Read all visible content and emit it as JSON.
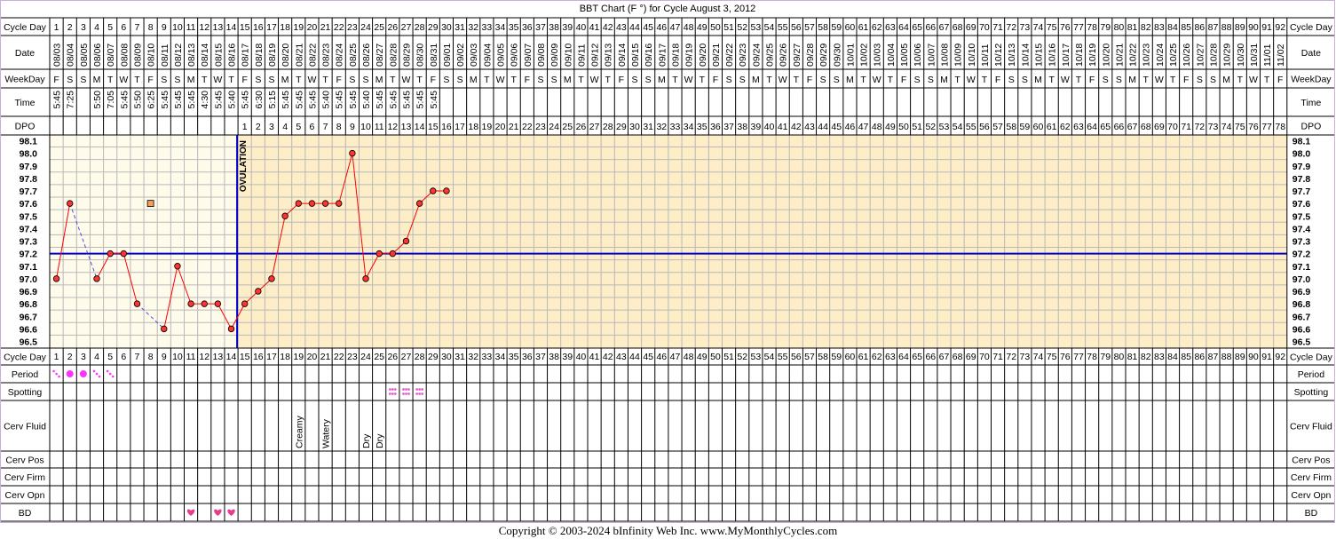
{
  "title": "BBT Chart (F °) for Cycle August 3, 2012",
  "row_labels": {
    "cycle_day": "Cycle Day",
    "date": "Date",
    "weekday": "WeekDay",
    "time": "Time",
    "dpo": "DPO",
    "period": "Period",
    "spotting": "Spotting",
    "cerv_fluid": "Cerv Fluid",
    "cerv_pos": "Cerv Pos",
    "cerv_firm": "Cerv Firm",
    "cerv_opn": "Cerv Opn",
    "bd": "BD"
  },
  "ovulation_label": "OVULATION",
  "ovulation_day": 14,
  "coverline": 97.2,
  "copyright": "Copyright © 2003-2024 bInfinity Web Inc.     www.MyMonthlyCycles.com",
  "colors": {
    "background": "#ffffff",
    "pre_ovulation_fill": "#fffbea",
    "post_ovulation_fill": "#fdeec8",
    "border": "#000000",
    "grid": "#b8b8b8",
    "ovulation_line": "#0000cc",
    "coverline": "#0000cc",
    "temp_line": "#ff0000",
    "temp_point": "#ff3333",
    "dashed_line": "#5050e0",
    "period": "#ff33ff",
    "spotting": "#e060d0",
    "heart": "#e83c8c"
  },
  "chart_data": {
    "type": "line",
    "title": "BBT Chart (F °) for Cycle August 3, 2012",
    "days": 92,
    "dates": [
      "08/03",
      "08/04",
      "08/05",
      "08/06",
      "08/07",
      "08/08",
      "08/09",
      "08/10",
      "08/11",
      "08/12",
      "08/13",
      "08/14",
      "08/15",
      "08/16",
      "08/17",
      "08/18",
      "08/19",
      "08/20",
      "08/21",
      "08/22",
      "08/23",
      "08/24",
      "08/25",
      "08/26",
      "08/27",
      "08/28",
      "08/29",
      "08/30",
      "08/31",
      "09/01",
      "09/02",
      "09/03",
      "09/04",
      "09/05",
      "09/06",
      "09/07",
      "09/08",
      "09/09",
      "09/10",
      "09/11",
      "09/12",
      "09/13",
      "09/14",
      "09/15",
      "09/16",
      "09/17",
      "09/18",
      "09/19",
      "09/20",
      "09/21",
      "09/22",
      "09/23",
      "09/24",
      "09/25",
      "09/26",
      "09/27",
      "09/28",
      "09/29",
      "09/30",
      "10/01",
      "10/02",
      "10/03",
      "10/04",
      "10/05",
      "10/06",
      "10/07",
      "10/08",
      "10/09",
      "10/10",
      "10/11",
      "10/12",
      "10/13",
      "10/14",
      "10/15",
      "10/16",
      "10/17",
      "10/18",
      "10/19",
      "10/20",
      "10/21",
      "10/22",
      "10/23",
      "10/24",
      "10/25",
      "10/26",
      "10/27",
      "10/28",
      "10/29",
      "10/30",
      "10/31",
      "11/01",
      "11/02"
    ],
    "weekdays": [
      "F",
      "S",
      "S",
      "M",
      "T",
      "W",
      "T",
      "F",
      "S",
      "S",
      "M",
      "T",
      "W",
      "T",
      "F",
      "S",
      "S",
      "M",
      "T",
      "W",
      "T",
      "F",
      "S",
      "S",
      "M",
      "T",
      "W",
      "T",
      "F",
      "S",
      "S",
      "M",
      "T",
      "W",
      "T",
      "F",
      "S",
      "S",
      "M",
      "T",
      "W",
      "T",
      "F",
      "S",
      "S",
      "M",
      "T",
      "W",
      "T",
      "F",
      "S",
      "S",
      "M",
      "T",
      "W",
      "T",
      "F",
      "S",
      "S",
      "M",
      "T",
      "W",
      "T",
      "F",
      "S",
      "S",
      "M",
      "T",
      "W",
      "T",
      "F",
      "S",
      "S",
      "M",
      "T",
      "W",
      "T",
      "F",
      "S",
      "S",
      "M",
      "T",
      "W",
      "T",
      "F",
      "S",
      "S",
      "M",
      "T",
      "W",
      "T",
      "F"
    ],
    "times": [
      "5:45",
      "7:25",
      "",
      "5:50",
      "7:05",
      "5:45",
      "5:50",
      "6:25",
      "5:45",
      "5:45",
      "5:45",
      "4:30",
      "5:45",
      "5:40",
      "5:45",
      "6:30",
      "5:15",
      "5:45",
      "5:45",
      "5:45",
      "5:40",
      "5:45",
      "5:45",
      "5:40",
      "5:45",
      "5:45",
      "5:45",
      "5:45",
      "5:45",
      "",
      "",
      "",
      "",
      "",
      "",
      "",
      "",
      "",
      "",
      "",
      "",
      "",
      "",
      "",
      "",
      "",
      "",
      "",
      "",
      "",
      "",
      "",
      "",
      "",
      "",
      "",
      "",
      "",
      "",
      "",
      "",
      "",
      "",
      "",
      "",
      "",
      "",
      "",
      "",
      "",
      "",
      "",
      "",
      "",
      "",
      "",
      "",
      "",
      "",
      "",
      "",
      "",
      "",
      "",
      "",
      "",
      "",
      "",
      "",
      "",
      "",
      "",
      "",
      "",
      ""
    ],
    "dpo_start_day": 15,
    "temperatures": [
      97.0,
      97.6,
      null,
      97.0,
      97.2,
      97.2,
      96.8,
      null,
      96.6,
      97.1,
      96.8,
      96.8,
      96.8,
      96.6,
      96.8,
      96.9,
      97.0,
      97.5,
      97.6,
      97.6,
      97.6,
      97.6,
      98.0,
      97.0,
      97.2,
      97.2,
      97.3,
      97.6,
      97.7,
      97.7
    ],
    "discarded_temps": [
      {
        "day": 8,
        "temp": 97.6
      }
    ],
    "y_ticks": [
      98.1,
      98.0,
      97.9,
      97.8,
      97.7,
      97.6,
      97.5,
      97.4,
      97.3,
      97.2,
      97.1,
      97.0,
      96.9,
      96.8,
      96.7,
      96.6,
      96.5
    ],
    "ylim": [
      96.5,
      98.1
    ],
    "period": [
      {
        "day": 1,
        "type": "light"
      },
      {
        "day": 2,
        "type": "heavy"
      },
      {
        "day": 3,
        "type": "heavy"
      },
      {
        "day": 4,
        "type": "light"
      },
      {
        "day": 5,
        "type": "light"
      }
    ],
    "spotting_days": [
      26,
      27,
      28
    ],
    "cerv_fluid": [
      {
        "day": 19,
        "value": "Creamy"
      },
      {
        "day": 21,
        "value": "Watery"
      },
      {
        "day": 24,
        "value": "Dry"
      },
      {
        "day": 25,
        "value": "Dry"
      }
    ],
    "bd_days": [
      11,
      13,
      14
    ]
  }
}
